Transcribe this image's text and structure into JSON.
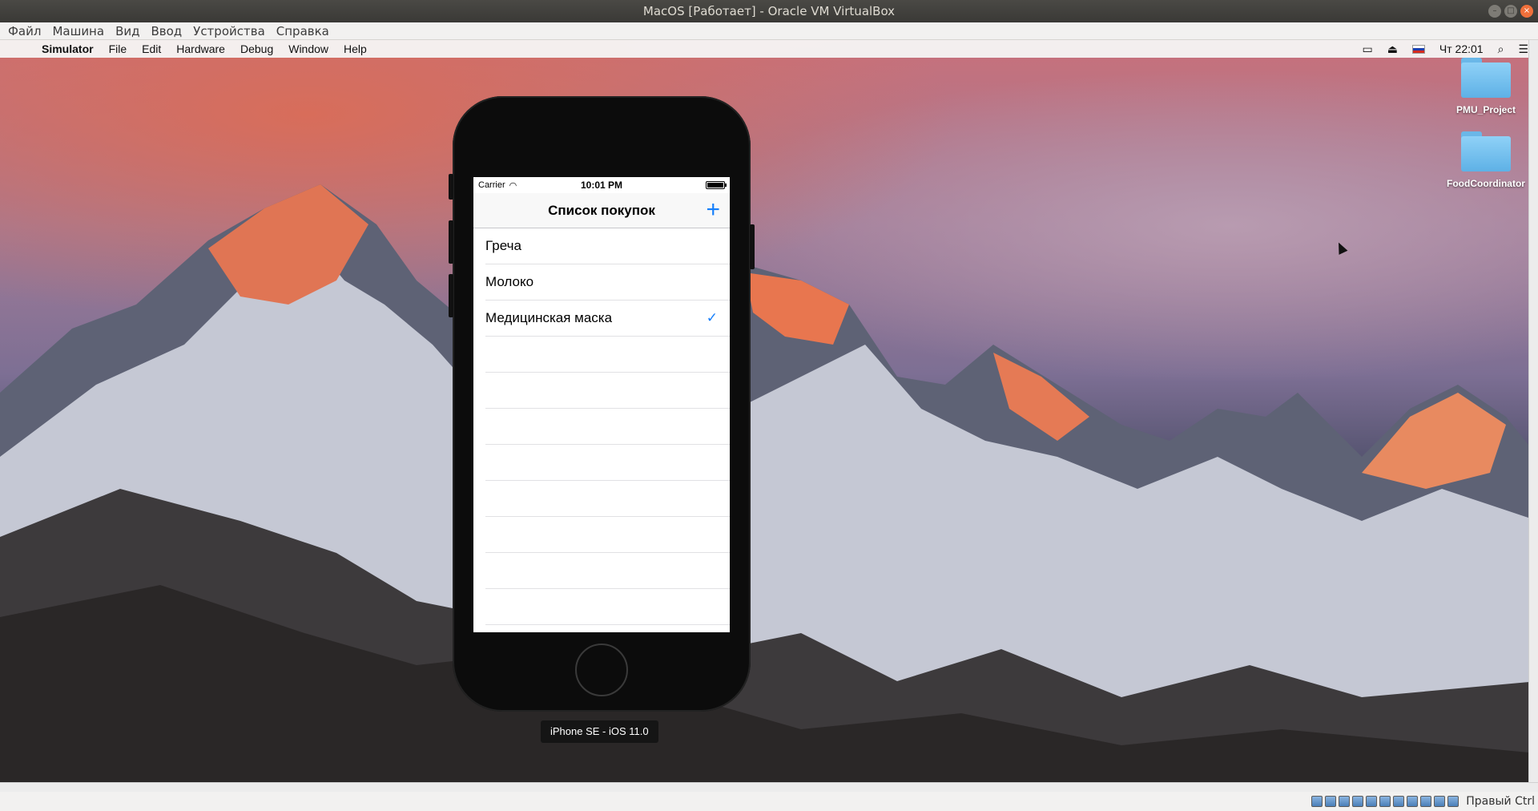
{
  "vbox": {
    "title": "MacOS [Работает] - Oracle VM VirtualBox",
    "menu": [
      "Файл",
      "Машина",
      "Вид",
      "Ввод",
      "Устройства",
      "Справка"
    ],
    "host_key": "Правый Ctrl"
  },
  "mac_menubar": {
    "app_name": "Simulator",
    "items": [
      "File",
      "Edit",
      "Hardware",
      "Debug",
      "Window",
      "Help"
    ],
    "clock": "Чт 22:01"
  },
  "desktop": {
    "icons": [
      "PMU_Project",
      "FoodCoordinator"
    ]
  },
  "simulator": {
    "device_label": "iPhone SE - iOS 11.0",
    "status": {
      "carrier": "Carrier",
      "time": "10:01 PM"
    },
    "nav_title": "Список покупок",
    "add_icon": "plus-icon",
    "rows": [
      {
        "label": "Греча",
        "checked": false
      },
      {
        "label": "Молоко",
        "checked": false
      },
      {
        "label": "Медицинская маска",
        "checked": true
      }
    ]
  },
  "colors": {
    "ios_tint": "#147efb",
    "vbox_close": "#f0703b"
  }
}
